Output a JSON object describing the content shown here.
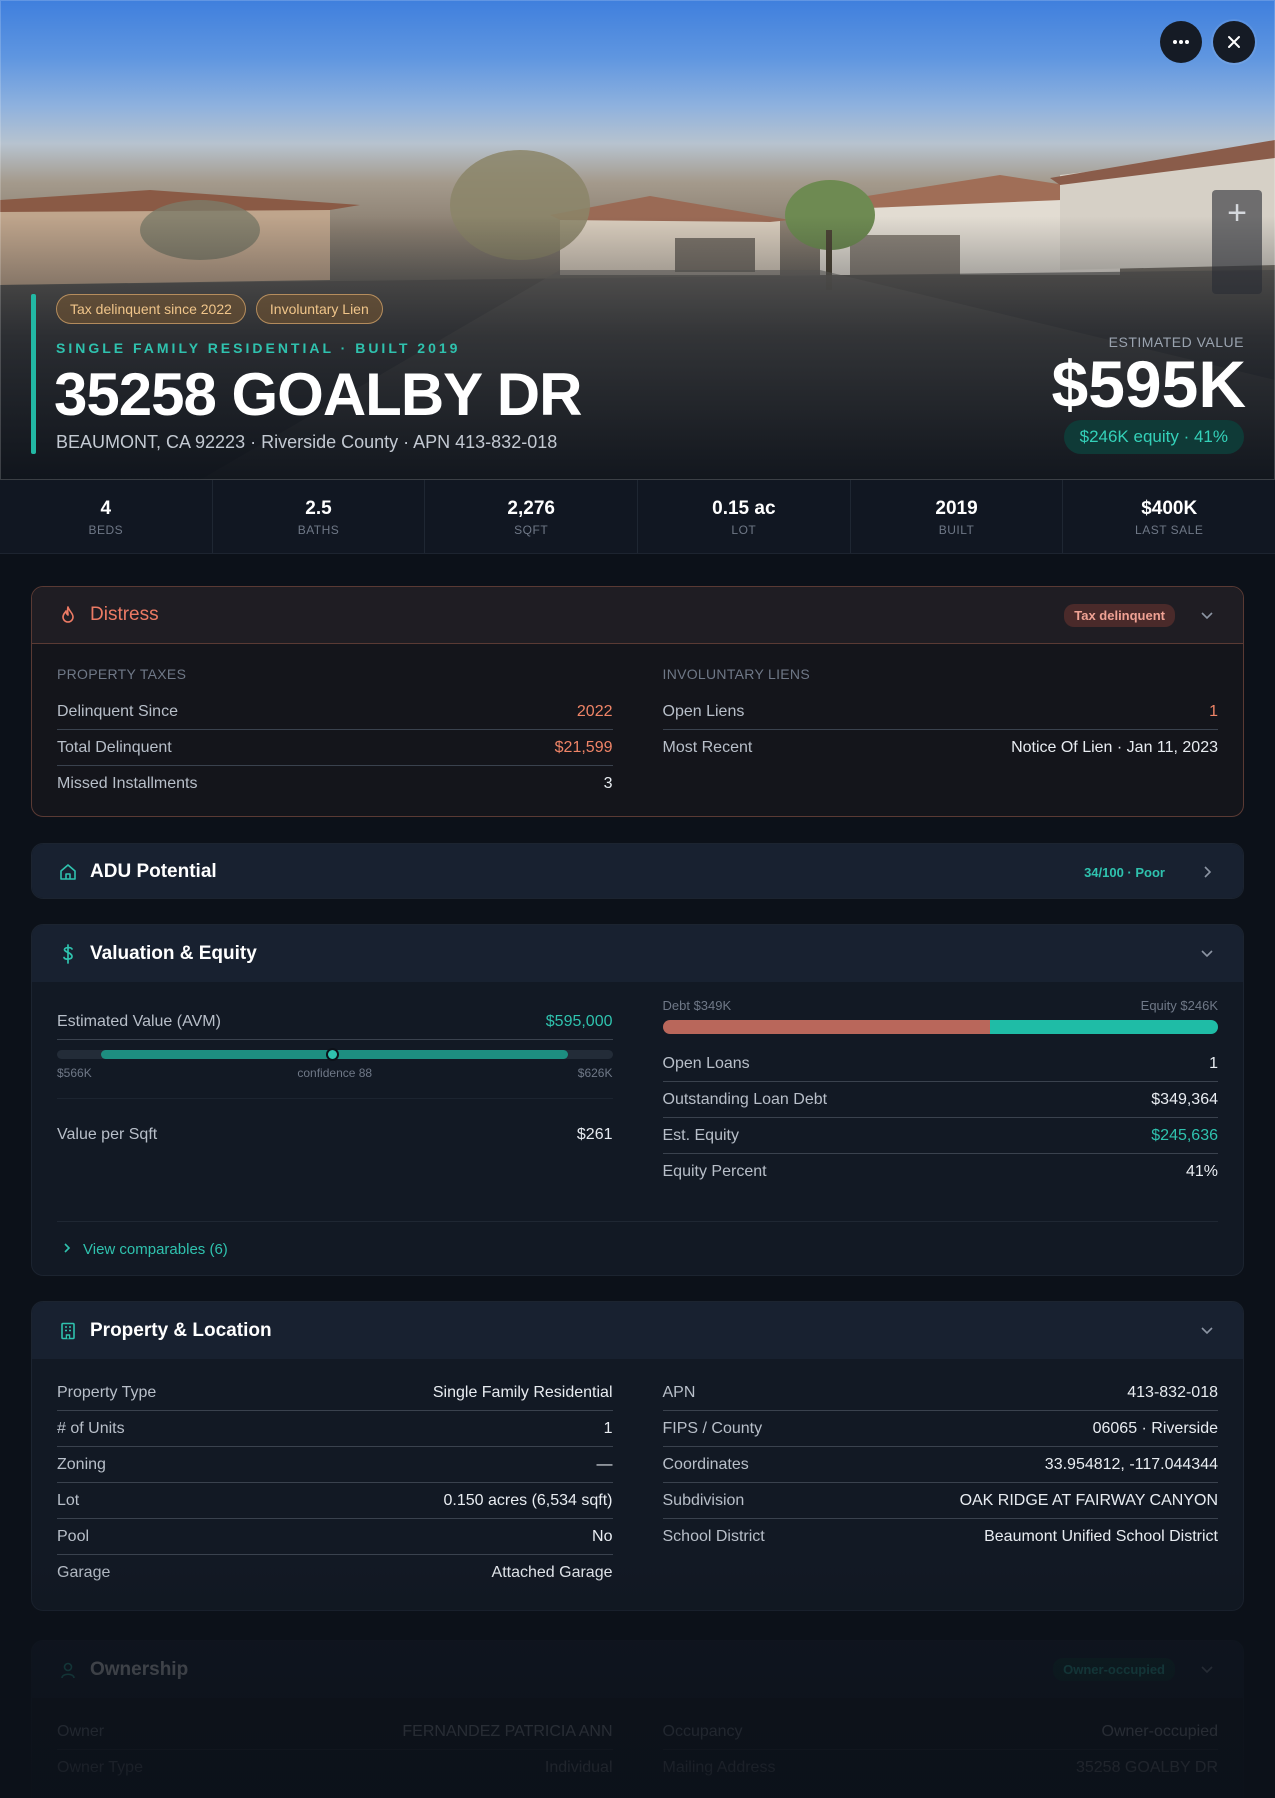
{
  "hero": {
    "badges": [
      "Tax delinquent since 2022",
      "Involuntary Lien"
    ],
    "kicker": "SINGLE FAMILY RESIDENTIAL · BUILT 2019",
    "address": "35258 GOALBY DR",
    "subline": "BEAUMONT, CA 92223 · Riverside County · APN 413-832-018",
    "estimated_label": "ESTIMATED VALUE",
    "estimated_value": "$595K",
    "equity_pill": "$246K equity · 41%",
    "more_icon": "more-horizontal-icon",
    "close_icon": "close-icon",
    "zoom_plus": "+"
  },
  "stats": [
    {
      "value": "4",
      "label": "BEDS"
    },
    {
      "value": "2.5",
      "label": "BATHS"
    },
    {
      "value": "2,276",
      "label": "SQFT"
    },
    {
      "value": "0.15 ac",
      "label": "LOT"
    },
    {
      "value": "2019",
      "label": "BUILT"
    },
    {
      "value": "$400K",
      "label": "LAST SALE"
    }
  ],
  "distress": {
    "title": "Distress",
    "tag": "Tax delinquent",
    "left_label": "PROPERTY TAXES",
    "left_rows": [
      {
        "k": "Delinquent Since",
        "v": "2022"
      },
      {
        "k": "Total Delinquent",
        "v": "$21,599"
      },
      {
        "k": "Missed Installments",
        "v": "3"
      }
    ],
    "right_label": "INVOLUNTARY LIENS",
    "right_rows": [
      {
        "k": "Open Liens",
        "v": "1"
      },
      {
        "k": "Most Recent",
        "v": "Notice Of Lien · Jan 11, 2023"
      }
    ],
    "colors": {
      "accent": "#ec7a64",
      "border": "#5a3a34"
    }
  },
  "adu": {
    "title": "ADU Potential",
    "score": "34/100 · Poor"
  },
  "valuation": {
    "title": "Valuation & Equity",
    "avm_label": "Estimated Value (AVM)",
    "avm_value": "$595,000",
    "range_low": "$566K",
    "range_mid": "confidence 88",
    "range_high": "$626K",
    "vps_label": "Value per Sqft",
    "vps_value": "$261",
    "debt_label": "Debt $349K",
    "equity_label": "Equity $246K",
    "debt_fraction": 0.59,
    "rows": [
      {
        "k": "Open Loans",
        "v": "1"
      },
      {
        "k": "Outstanding Loan Debt",
        "v": "$349,364"
      },
      {
        "k": "Est. Equity",
        "v": "$245,636"
      },
      {
        "k": "Equity Percent",
        "v": "41%"
      }
    ],
    "comps_link": "View comparables (6)"
  },
  "property": {
    "title": "Property & Location",
    "left_rows": [
      {
        "k": "Property Type",
        "v": "Single Family Residential"
      },
      {
        "k": "# of Units",
        "v": "1"
      },
      {
        "k": "Zoning",
        "v": "—"
      },
      {
        "k": "Lot",
        "v": "0.150 acres (6,534 sqft)"
      },
      {
        "k": "Pool",
        "v": "No"
      },
      {
        "k": "Garage",
        "v": "Attached Garage"
      }
    ],
    "right_rows": [
      {
        "k": "APN",
        "v": "413-832-018"
      },
      {
        "k": "FIPS / County",
        "v": "06065 · Riverside"
      },
      {
        "k": "Coordinates",
        "v": "33.954812, -117.044344"
      },
      {
        "k": "Subdivision",
        "v": "OAK RIDGE AT FAIRWAY CANYON"
      },
      {
        "k": "School District",
        "v": "Beaumont Unified School District"
      }
    ]
  },
  "ownership": {
    "title": "Ownership",
    "tag": "Owner-occupied",
    "left_rows": [
      {
        "k": "Owner",
        "v": "FERNANDEZ PATRICIA ANN"
      },
      {
        "k": "Owner Type",
        "v": "Individual"
      }
    ],
    "right_rows": [
      {
        "k": "Occupancy",
        "v": "Owner-occupied"
      },
      {
        "k": "Mailing Address",
        "v": "35258 GOALBY DR"
      }
    ]
  },
  "colors": {
    "accent_teal": "#2fc2ae",
    "accent_red": "#ef8467",
    "background": "#0c1119",
    "card": "#121924"
  }
}
